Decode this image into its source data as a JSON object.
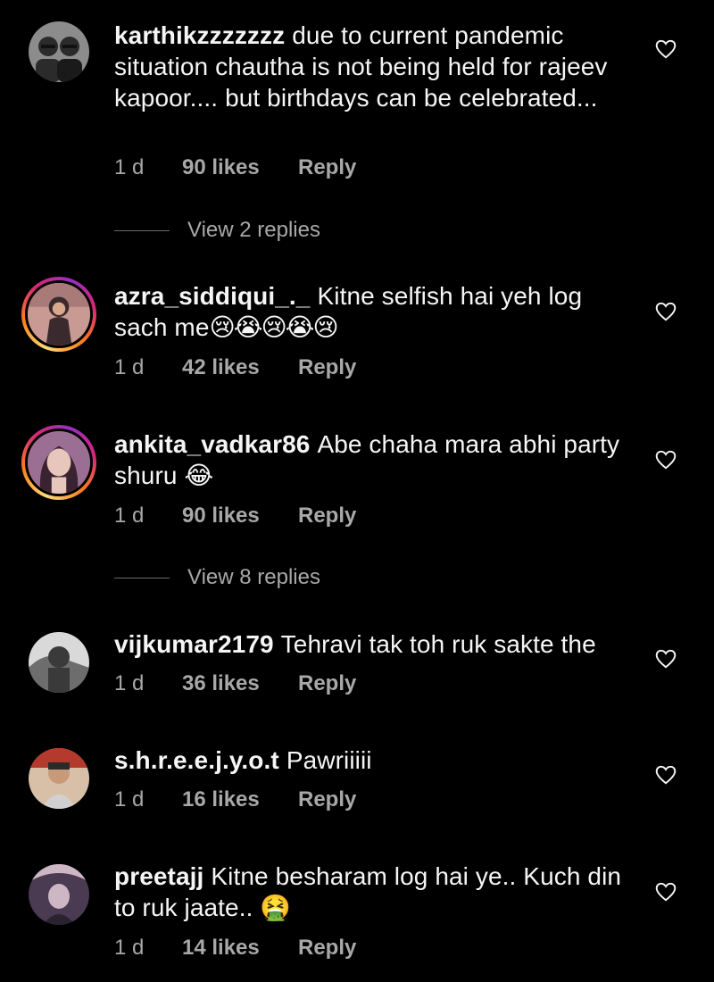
{
  "comments": [
    {
      "username": "karthikzzzzzzz",
      "text": "due to current pandemic situation chautha is not being held for rajeev kapoor.... but birthdays can be celebrated...",
      "emoji": "",
      "time": "1 d",
      "likes": "90 likes",
      "reply": "Reply",
      "view_replies": "View 2 replies",
      "avatar_colors": [
        "#8c8c8c",
        "#2b2b2b"
      ],
      "has_story_ring": false
    },
    {
      "username": "azra_siddiqui_._",
      "text": "Kitne selfish hai yeh log sach me",
      "emoji": "😢😭😢😭😢",
      "time": "1 d",
      "likes": "42 likes",
      "reply": "Reply",
      "avatar_colors": [
        "#c89a93",
        "#3b2a2d"
      ],
      "has_story_ring": true
    },
    {
      "username": "ankita_vadkar86",
      "text": "Abe chaha mara abhi party shuru",
      "emoji": "😂",
      "time": "1 d",
      "likes": "90 likes",
      "reply": "Reply",
      "view_replies": "View 8 replies",
      "avatar_colors": [
        "#9a6f93",
        "#e7c6bc"
      ],
      "has_story_ring": true
    },
    {
      "username": "vijkumar2179",
      "text": "Tehravi tak toh ruk sakte the",
      "emoji": "",
      "time": "1 d",
      "likes": "36 likes",
      "reply": "Reply",
      "avatar_colors": [
        "#d9d9d9",
        "#3a3a3a"
      ],
      "has_story_ring": false
    },
    {
      "username": "s.h.r.e.e.j.y.o.t",
      "text": "Pawriiiii",
      "emoji": "",
      "time": "1 d",
      "likes": "16 likes",
      "reply": "Reply",
      "avatar_colors": [
        "#b33a2c",
        "#d8c0a8"
      ],
      "has_story_ring": false
    },
    {
      "username": "preetajj",
      "text": "Kitne besharam log hai ye.. Kuch din to ruk jaate..",
      "emoji": "🤮",
      "time": "1 d",
      "likes": "14 likes",
      "reply": "Reply",
      "avatar_colors": [
        "#4a3a52",
        "#cdb7c4"
      ],
      "has_story_ring": false
    }
  ],
  "colors": {
    "background": "#000000",
    "text": "#f5f5f5",
    "muted": "#a8a8a8"
  },
  "icons": {
    "like": "heart-outline-icon"
  }
}
